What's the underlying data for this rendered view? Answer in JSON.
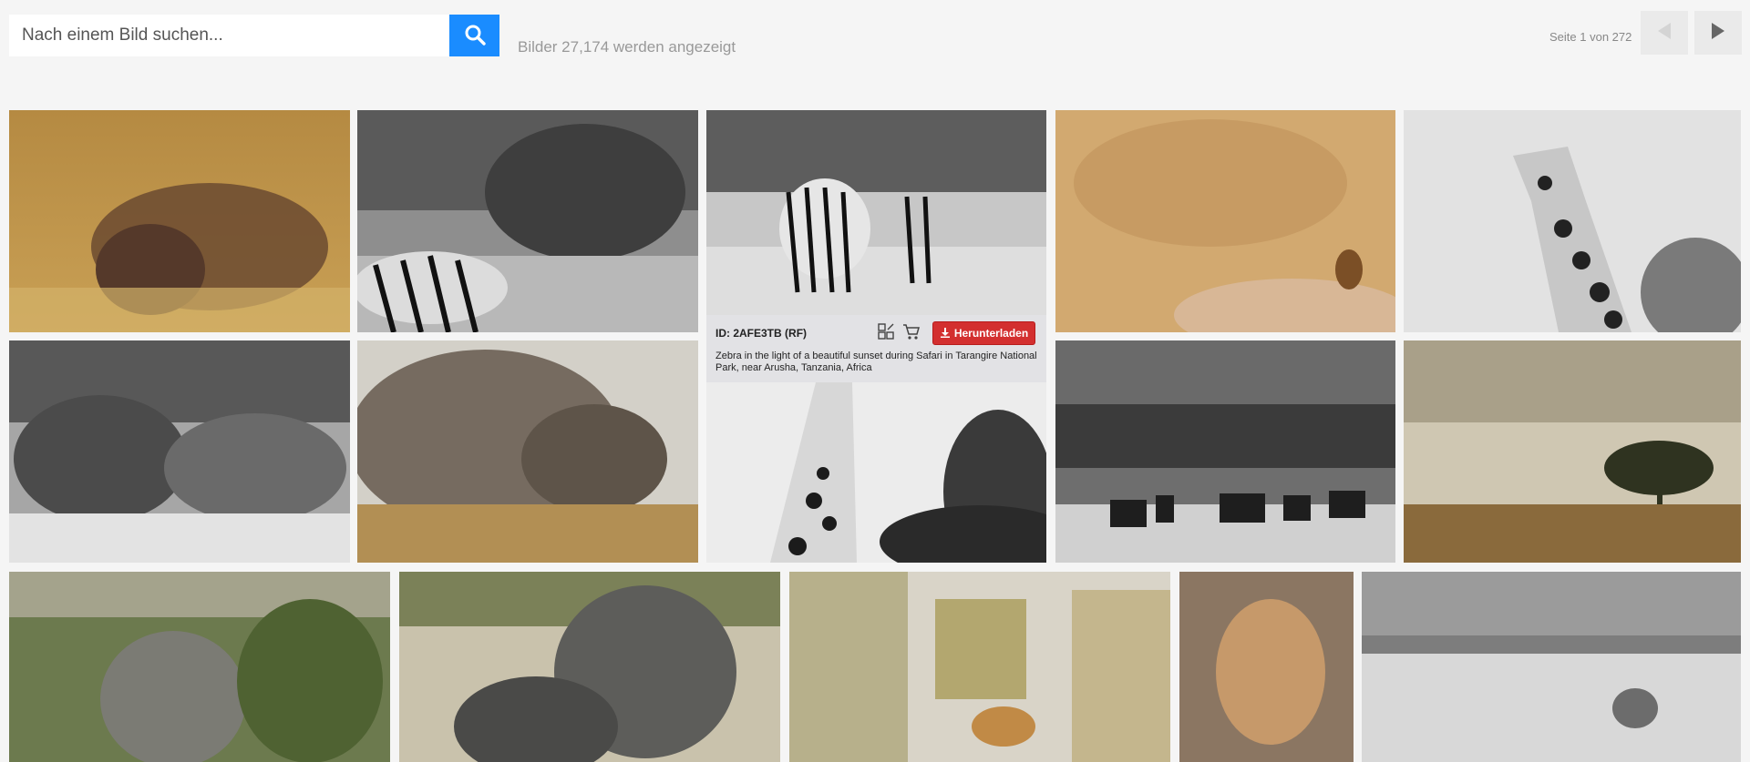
{
  "search": {
    "placeholder": "Nach einem Bild suchen...",
    "value": ""
  },
  "results": {
    "count_text": "Bilder 27,174 werden angezeigt",
    "page_text": "Seite 1 von 272"
  },
  "colors": {
    "accent": "#1a8cff",
    "download": "#d32f2f",
    "background": "#f5f5f5"
  },
  "grid": {
    "tiles": [
      {
        "subject": "warthog in golden grass"
      },
      {
        "subject": "zebra and elephant black and white"
      },
      {
        "subject": "zebras black and white"
      },
      {
        "subject": "small animal on rock"
      },
      {
        "subject": "giraffe black and white"
      },
      {
        "subject": "elephants black and white"
      },
      {
        "subject": "elephant close-up"
      },
      {
        "subject": "giraffe black and white"
      },
      {
        "subject": "zebra herd black and white"
      },
      {
        "subject": "acacia tree on savanna"
      },
      {
        "subject": "elephant in bushes"
      },
      {
        "subject": "elephant mother and calf"
      },
      {
        "subject": "safari jeeps with lion"
      },
      {
        "subject": "lioness walking"
      },
      {
        "subject": "lion black and white"
      }
    ]
  },
  "hover_card": {
    "id_text": "ID: 2AFE3TB",
    "license": "(RF)",
    "download_label": "Herunterladen",
    "caption": "Zebra in the light of a beautiful sunset during Safari in Tarangire National Park, near Arusha, Tanzania, Africa"
  }
}
